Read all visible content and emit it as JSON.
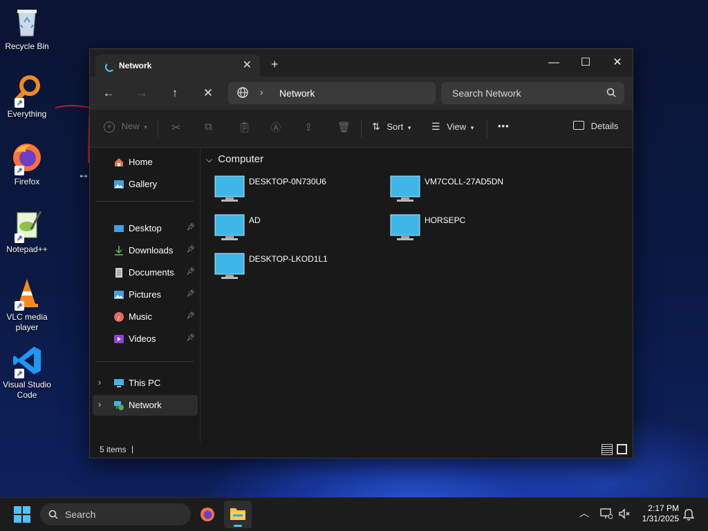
{
  "desktop": {
    "icons": [
      {
        "label": "Recycle Bin"
      },
      {
        "label": "Everything"
      },
      {
        "label": "Firefox"
      },
      {
        "label": "Notepad++"
      },
      {
        "label": "VLC media player"
      },
      {
        "label": "Visual Studio Code"
      }
    ]
  },
  "window": {
    "tab_title": "Network",
    "tab_close": "✕",
    "new_tab": "+",
    "controls": {
      "minimize": "—",
      "maximize": "☐",
      "close": "✕"
    },
    "address": {
      "crumb": "Network",
      "separator": "›"
    },
    "search_placeholder": "Search Network"
  },
  "toolbar": {
    "new_label": "New",
    "sort_label": "Sort",
    "view_label": "View",
    "more_label": "•••",
    "details_label": "Details"
  },
  "sidebar": {
    "top": [
      {
        "label": "Home"
      },
      {
        "label": "Gallery"
      }
    ],
    "quick_access": [
      {
        "label": "Desktop"
      },
      {
        "label": "Downloads"
      },
      {
        "label": "Documents"
      },
      {
        "label": "Pictures"
      },
      {
        "label": "Music"
      },
      {
        "label": "Videos"
      }
    ],
    "bottom": [
      {
        "label": "This PC"
      },
      {
        "label": "Network",
        "selected": true
      }
    ]
  },
  "content": {
    "group_label": "Computer",
    "computers": [
      {
        "name": "DESKTOP-0N730U6"
      },
      {
        "name": "VM7COLL-27AD5DN"
      },
      {
        "name": "AD"
      },
      {
        "name": "HORSEPC"
      },
      {
        "name": "DESKTOP-LKOD1L1"
      }
    ]
  },
  "status": {
    "item_count": "5 items"
  },
  "taskbar": {
    "search_placeholder": "Search",
    "time": "2:17 PM",
    "date": "1/31/2025"
  },
  "colors": {
    "accent": "#4cc2ff",
    "monitor": "#3fb6e8",
    "window_bg": "#191919"
  }
}
